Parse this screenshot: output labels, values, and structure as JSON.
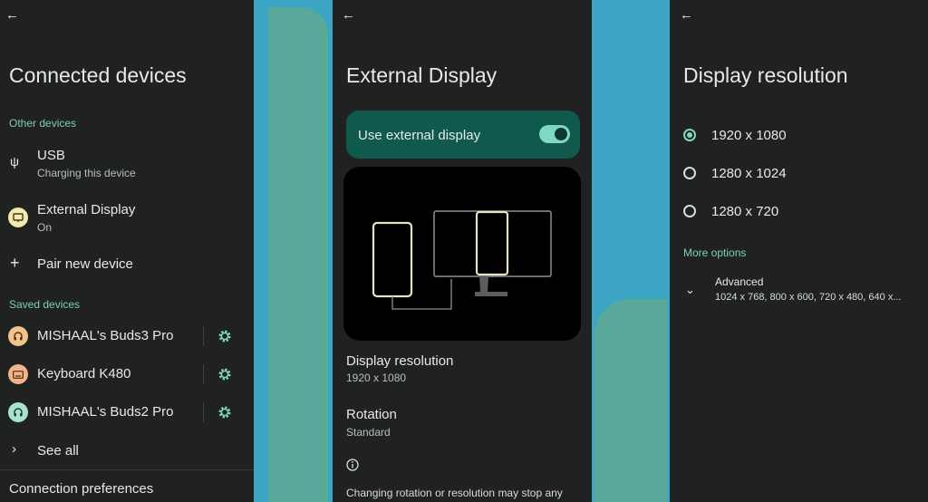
{
  "connected_devices": {
    "title": "Connected devices",
    "other_devices_header": "Other devices",
    "usb": {
      "title": "USB",
      "subtitle": "Charging this device"
    },
    "external_display": {
      "title": "External Display",
      "subtitle": "On"
    },
    "pair_new_device": "Pair new device",
    "saved_devices_header": "Saved devices",
    "saved_devices": [
      {
        "name": "MISHAAL's Buds3 Pro",
        "icon": "headphones-icon",
        "color": "#f2c38a"
      },
      {
        "name": "Keyboard K480",
        "icon": "keyboard-icon",
        "color": "#f0b58a"
      },
      {
        "name": "MISHAAL's Buds2 Pro",
        "icon": "headphones-icon",
        "color": "#a8e3cf"
      }
    ],
    "see_all": "See all",
    "connection_preferences": "Connection preferences"
  },
  "external_display": {
    "title": "External Display",
    "use_external_display": {
      "label": "Use external display",
      "enabled": true
    },
    "display_resolution": {
      "title": "Display resolution",
      "value": "1920 x 1080"
    },
    "rotation": {
      "title": "Rotation",
      "value": "Standard"
    },
    "info_text": "Changing rotation or resolution may stop any"
  },
  "display_resolution": {
    "title": "Display resolution",
    "options": [
      {
        "label": "1920 x 1080",
        "selected": true
      },
      {
        "label": "1280 x 1024",
        "selected": false
      },
      {
        "label": "1280 x 720",
        "selected": false
      }
    ],
    "more_options_header": "More options",
    "advanced": {
      "title": "Advanced",
      "subtitle": "1024 x 768, 800 x 600, 720 x 480, 640 x..."
    }
  },
  "colors": {
    "panel_bg": "#1f2221",
    "accent": "#7fd8bf",
    "section_header": "#7fcfb4",
    "toggle_card": "#0f5a4d",
    "wallpaper_blue": "#3da5c4",
    "wallpaper_green": "#59a99a"
  }
}
